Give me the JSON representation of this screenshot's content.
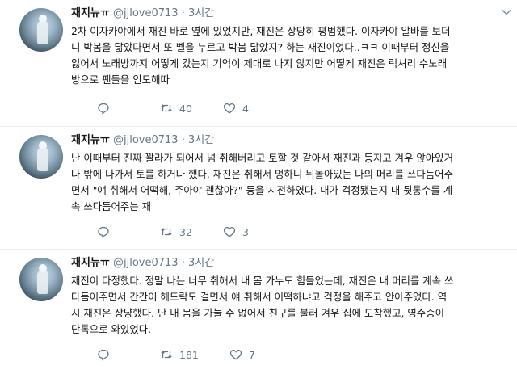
{
  "tweets": [
    {
      "name": "재지뉴ㅠ",
      "handle": "@jjlove0713",
      "separator": "·",
      "time": "3시간",
      "lines": [
        "2차 이자카야에서 재진 바로 옆에 있었지만, 재진은 상당히 평범했다. 이자카야 알바를 보더",
        "니 박봄을 닮았다면서 또 벨을 누르고 박봄 닮았지? 하는 재진이었다..ㅋㅋ 이때부터 정신을",
        "잃어서 노래방까지 어떻게 갔는지 기억이 제대로 나지 않지만 어떻게 재진은 럭셔리 수노래",
        "방으로 팬들을 인도해따"
      ],
      "reply_count": "",
      "retweet_count": "40",
      "like_count": "4"
    },
    {
      "name": "재지뉴ㅠ",
      "handle": "@jjlove0713",
      "separator": "·",
      "time": "3시간",
      "lines": [
        "난 이때부터 진짜 꽐라가 되어서 넘 취해버리고 토할 것 같아서 재진과 등지고 겨우 앉아있거",
        "나 밖에 나가서 토를 하거나 했다. 재진은 취해서 멍하니 뒤돌아있는 나의 머리를 쓰다듬어주",
        "면서 \"얘 취해서 어떡해, 주아야 괜찮아?\" 등을 시전하였다. 내가 걱정됐는지 내 뒷통수를 계",
        "속 쓰다듬어주는 재"
      ],
      "reply_count": "",
      "retweet_count": "32",
      "like_count": "3"
    },
    {
      "name": "재지뉴ㅠ",
      "handle": "@jjlove0713",
      "separator": "·",
      "time": "3시간",
      "lines": [
        "재진이 다정했다. 정말 나는 너무 취해서 내 몸 가누도 힘들었는데, 재진은 내 머리를 계속 쓰",
        "다듬어주면서 간간이 헤드락도 걸면서 얘 취해서 어떡하냐고 걱정을 해주고 안아주었다. 역",
        "시 재진은 상냥했다. 난 내 몸을 가눌 수 없어서 친구를 불러 겨우 집에 도착했고, 영수증이",
        "단톡으로 와있었다."
      ],
      "reply_count": "",
      "retweet_count": "181",
      "like_count": "7"
    }
  ],
  "icons": {
    "reply": "reply-icon",
    "retweet": "retweet-icon",
    "like": "heart-icon",
    "menu": "chevron-down-icon"
  },
  "colors": {
    "text": "#14171a",
    "secondary": "#657786",
    "divider": "#e6ecf0"
  }
}
